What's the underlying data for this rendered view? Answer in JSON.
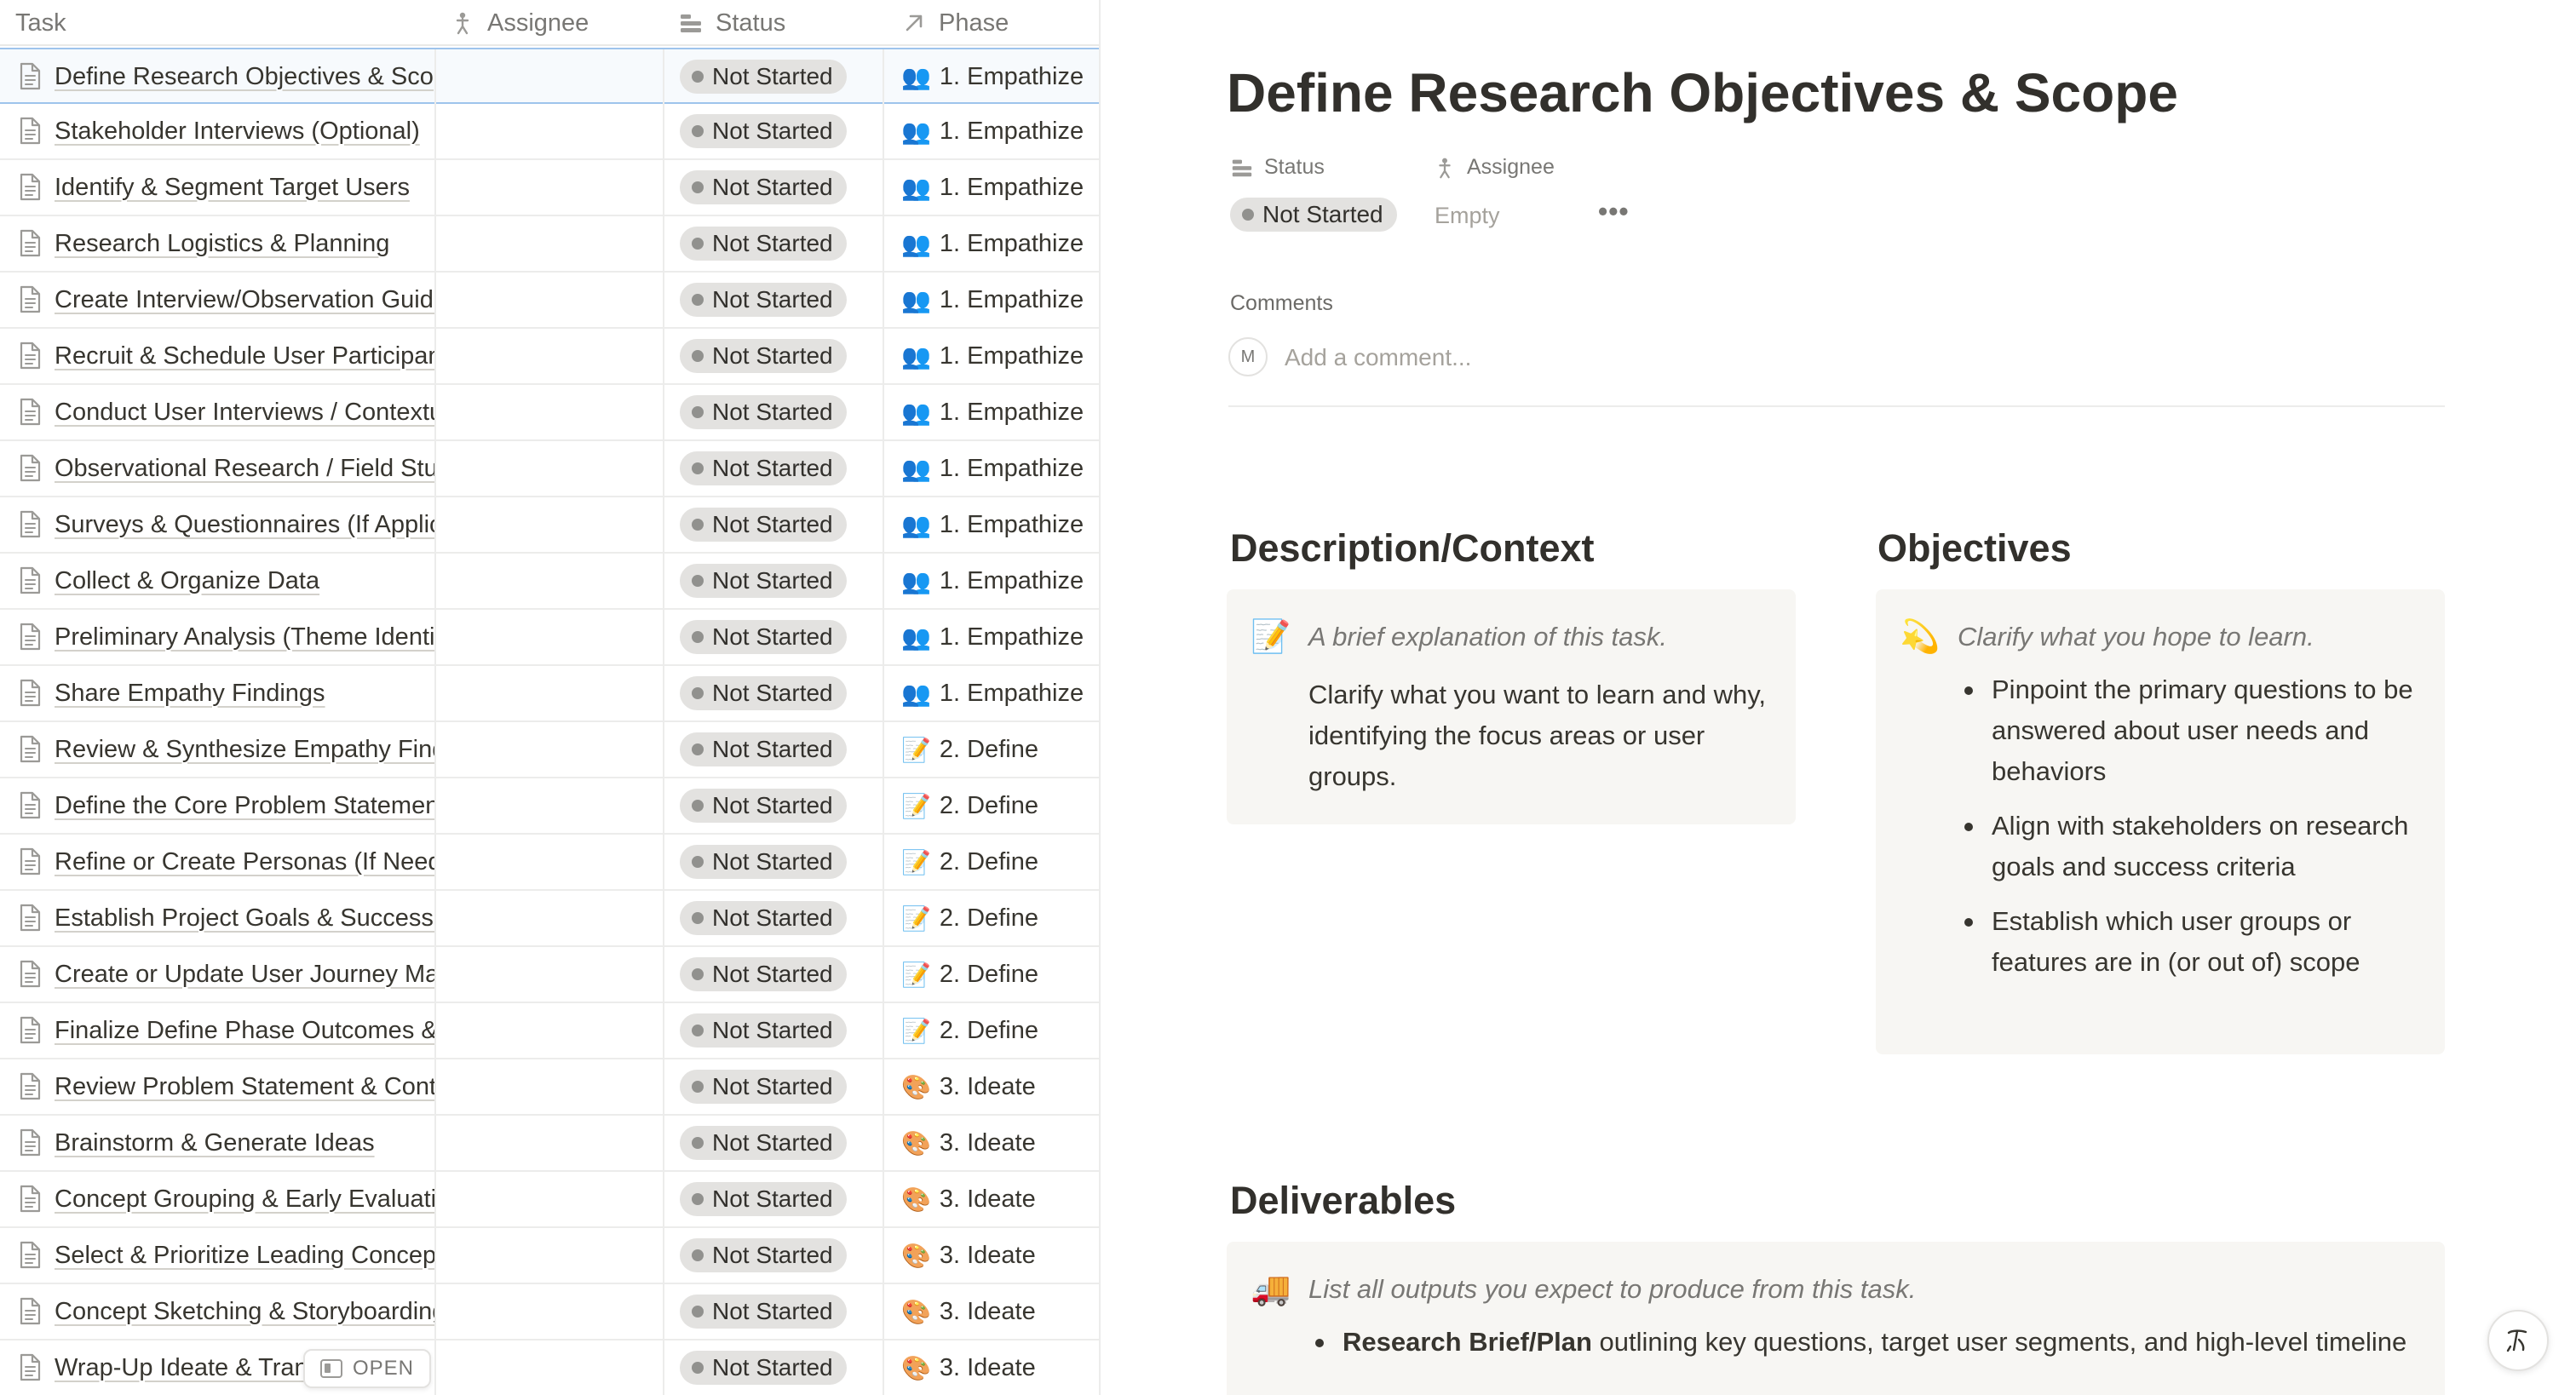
{
  "table": {
    "columns": {
      "task": "Task",
      "assignee": "Assignee",
      "status": "Status",
      "phase": "Phase"
    },
    "rows": [
      {
        "task": "Define Research Objectives & Scope",
        "status": "Not Started",
        "phase_emoji": "👥",
        "phase": "1. Empathize"
      },
      {
        "task": "Stakeholder Interviews (Optional)",
        "status": "Not Started",
        "phase_emoji": "👥",
        "phase": "1. Empathize"
      },
      {
        "task": "Identify & Segment Target Users",
        "status": "Not Started",
        "phase_emoji": "👥",
        "phase": "1. Empathize"
      },
      {
        "task": "Research Logistics & Planning",
        "status": "Not Started",
        "phase_emoji": "👥",
        "phase": "1. Empathize"
      },
      {
        "task": "Create Interview/Observation Guide",
        "status": "Not Started",
        "phase_emoji": "👥",
        "phase": "1. Empathize"
      },
      {
        "task": "Recruit & Schedule User Participants",
        "status": "Not Started",
        "phase_emoji": "👥",
        "phase": "1. Empathize"
      },
      {
        "task": "Conduct User Interviews / Contextual Inquiry",
        "status": "Not Started",
        "phase_emoji": "👥",
        "phase": "1. Empathize"
      },
      {
        "task": "Observational Research / Field Studies",
        "status": "Not Started",
        "phase_emoji": "👥",
        "phase": "1. Empathize"
      },
      {
        "task": "Surveys & Questionnaires (If Applicable)",
        "status": "Not Started",
        "phase_emoji": "👥",
        "phase": "1. Empathize"
      },
      {
        "task": "Collect & Organize Data",
        "status": "Not Started",
        "phase_emoji": "👥",
        "phase": "1. Empathize"
      },
      {
        "task": "Preliminary Analysis (Theme Identification)",
        "status": "Not Started",
        "phase_emoji": "👥",
        "phase": "1. Empathize"
      },
      {
        "task": "Share Empathy Findings",
        "status": "Not Started",
        "phase_emoji": "👥",
        "phase": "1. Empathize"
      },
      {
        "task": "Review & Synthesize Empathy Findings",
        "status": "Not Started",
        "phase_emoji": "📝",
        "phase": "2. Define"
      },
      {
        "task": "Define the Core Problem Statement",
        "status": "Not Started",
        "phase_emoji": "📝",
        "phase": "2. Define"
      },
      {
        "task": "Refine or Create Personas (If Needed)",
        "status": "Not Started",
        "phase_emoji": "📝",
        "phase": "2. Define"
      },
      {
        "task": "Establish Project Goals & Success Metrics",
        "status": "Not Started",
        "phase_emoji": "📝",
        "phase": "2. Define"
      },
      {
        "task": "Create or Update User Journey Map",
        "status": "Not Started",
        "phase_emoji": "📝",
        "phase": "2. Define"
      },
      {
        "task": "Finalize Define Phase Outcomes & Alignment",
        "status": "Not Started",
        "phase_emoji": "📝",
        "phase": "2. Define"
      },
      {
        "task": "Review Problem Statement & Context",
        "status": "Not Started",
        "phase_emoji": "🎨",
        "phase": "3. Ideate"
      },
      {
        "task": "Brainstorm & Generate Ideas",
        "status": "Not Started",
        "phase_emoji": "🎨",
        "phase": "3. Ideate"
      },
      {
        "task": "Concept Grouping & Early Evaluation",
        "status": "Not Started",
        "phase_emoji": "🎨",
        "phase": "3. Ideate"
      },
      {
        "task": "Select & Prioritize Leading Concepts",
        "status": "Not Started",
        "phase_emoji": "🎨",
        "phase": "3. Ideate"
      },
      {
        "task": "Concept Sketching & Storyboarding",
        "status": "Not Started",
        "phase_emoji": "🎨",
        "phase": "3. Ideate"
      },
      {
        "task": "Wrap-Up Ideate & Transition",
        "status": "Not Started",
        "phase_emoji": "🎨",
        "phase": "3. Ideate"
      }
    ],
    "open_button": "OPEN"
  },
  "detail": {
    "title": "Define Research Objectives & Scope",
    "status_label": "Status",
    "assignee_label": "Assignee",
    "status_value": "Not Started",
    "assignee_value": "Empty",
    "more": "•••",
    "comments_label": "Comments",
    "comment_avatar": "M",
    "comment_placeholder": "Add a comment...",
    "description": {
      "heading": "Description/Context",
      "emoji": "📝",
      "hint": "A brief explanation of this task.",
      "body": "Clarify what you want to learn and why, identifying the focus areas or user groups."
    },
    "objectives": {
      "heading": "Objectives",
      "emoji": "💫",
      "hint": "Clarify what you hope to learn.",
      "items": [
        "Pinpoint the primary questions to be answered about user needs and behaviors",
        "Align with stakeholders on research goals and success criteria",
        "Establish which user groups or features are in (or out of) scope"
      ]
    },
    "deliverables": {
      "heading": "Deliverables",
      "emoji": "🚚",
      "hint": "List all outputs you expect to produce from this task.",
      "item_bold": "Research Brief/Plan",
      "item_rest": " outlining key questions, target user segments, and high-level timeline"
    }
  }
}
